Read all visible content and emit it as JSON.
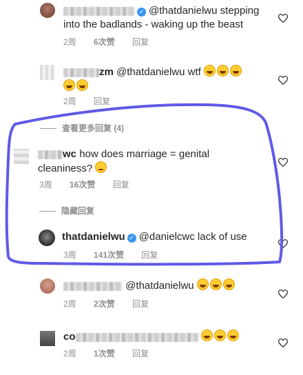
{
  "comments": [
    {
      "username_visible": "",
      "verified": true,
      "text_line1": "@thatdanielwu stepping",
      "text_line2": "into the badlands - waking up the beast",
      "age": "2周",
      "likes": "6次赞",
      "reply": "回复"
    },
    {
      "username_visible": "zm",
      "verified": false,
      "text": "@thatdanielwu wtf",
      "age": "2周",
      "reply": "回复"
    },
    {
      "view_more": "查看更多回复 (4)"
    },
    {
      "username_visible": "wc",
      "verified": false,
      "text_line1": "how does marriage = genital",
      "text_line2": "cleaniness?",
      "age": "3周",
      "likes": "16次赞",
      "reply": "回复",
      "hide_replies": "隐藏回复"
    },
    {
      "username": "thatdanielwu",
      "verified": true,
      "text": "@danielcwc lack of use",
      "age": "3周",
      "likes": "141次赞",
      "reply": "回复"
    },
    {
      "username_visible": "",
      "verified": false,
      "text": "@thatdanielwu",
      "age": "2周",
      "likes": "2次赞",
      "reply": "回复"
    },
    {
      "username_visible": "co",
      "verified": false,
      "text": "",
      "age": "2周",
      "likes": "1次赞",
      "reply": "回复"
    }
  ],
  "colors": {
    "annotation_stroke": "#5e5ae6",
    "meta": "#8e8e8e",
    "verified": "#3897f0"
  },
  "icons": [
    "heart-icon",
    "verified-icon",
    "rofl-emoji",
    "smirk-emoji",
    "joy-emoji"
  ]
}
